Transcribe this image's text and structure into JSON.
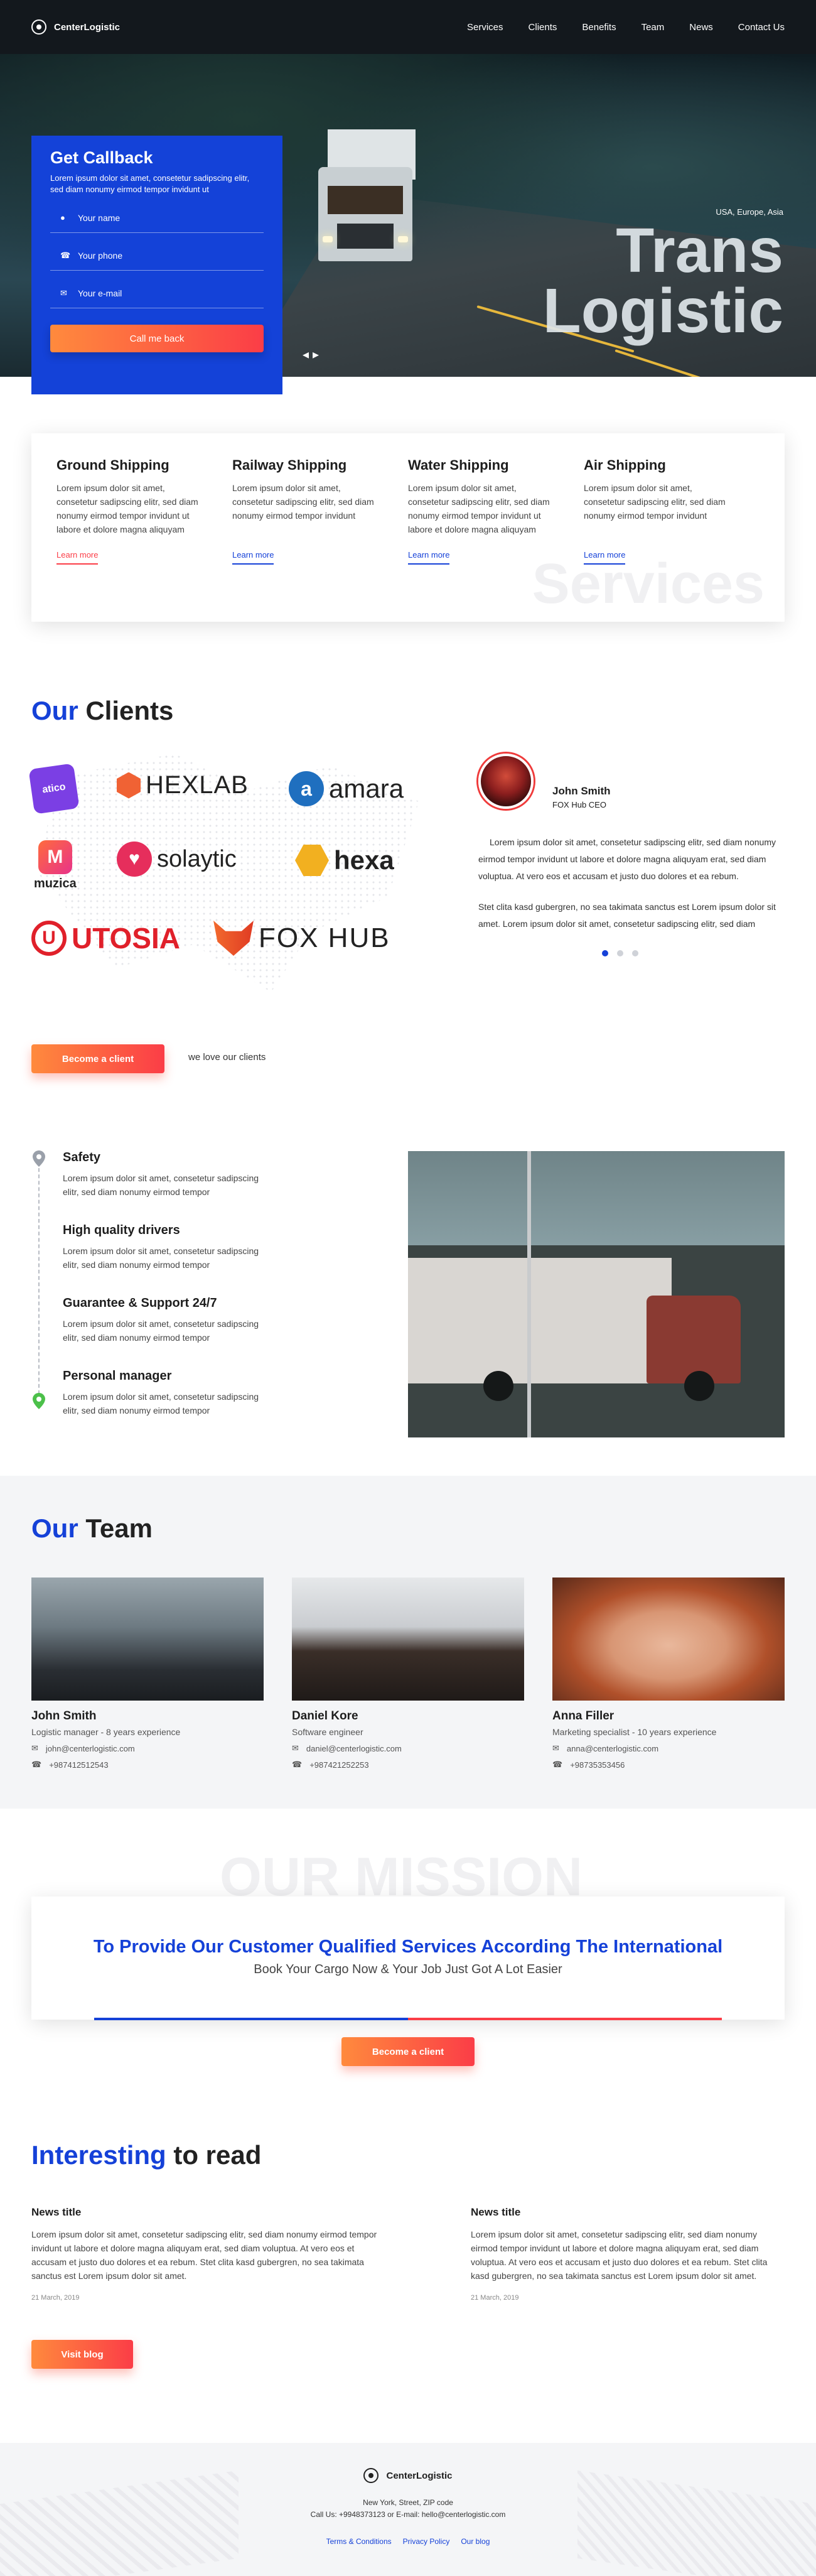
{
  "header": {
    "brand": "CenterLogistic",
    "nav": [
      "Services",
      "Clients",
      "Benefits",
      "Team",
      "News",
      "Contact Us"
    ]
  },
  "hero": {
    "location": "USA, Europe, Asia",
    "title_line1": "Trans",
    "title_line2": "Logistic"
  },
  "callback": {
    "title": "Get Callback",
    "description": "Lorem ipsum dolor sit amet, consetetur sadipscing elitr, sed diam nonumy eirmod tempor invidunt ut",
    "name_placeholder": "Your name",
    "phone_placeholder": "Your phone",
    "email_placeholder": "Your e-mail",
    "button": "Call me back"
  },
  "services": {
    "watermark": "Services",
    "items": [
      {
        "title": "Ground Shipping",
        "text": "Lorem ipsum dolor sit amet, consetetur sadipscing elitr, sed diam nonumy eirmod tempor invidunt ut labore et dolore magna aliquyam",
        "link": "Learn more",
        "color": "#fb3d47"
      },
      {
        "title": "Railway Shipping",
        "text": "Lorem ipsum dolor sit amet, consetetur sadipscing elitr, sed diam nonumy eirmod tempor invidunt",
        "link": "Learn more",
        "color": "#1541d8"
      },
      {
        "title": "Water Shipping",
        "text": "Lorem ipsum dolor sit amet, consetetur sadipscing elitr, sed diam nonumy eirmod tempor invidunt ut labore et dolore magna aliquyam",
        "link": "Learn more",
        "color": "#1541d8"
      },
      {
        "title": "Air Shipping",
        "text": "Lorem ipsum dolor sit amet, consetetur sadipscing elitr, sed diam nonumy eirmod tempor invidunt",
        "link": "Learn more",
        "color": "#1541d8"
      }
    ]
  },
  "clients": {
    "title_accent": "Our",
    "title_rest": "Clients",
    "logos": [
      "atico",
      "HEXLAB",
      "amara",
      "muzica",
      "solaytic",
      "hexa",
      "UTOSIA",
      "FOX HUB"
    ],
    "testimonial": {
      "name": "John Smith",
      "role": "FOX Hub CEO",
      "text1": "Lorem ipsum dolor sit amet, consetetur sadipscing elitr, sed diam nonumy eirmod tempor invidunt ut labore et dolore magna aliquyam erat, sed diam voluptua. At vero eos et accusam et justo duo dolores et ea rebum.",
      "text2": "Stet clita kasd gubergren, no sea takimata sanctus est Lorem ipsum dolor sit amet. Lorem ipsum dolor sit amet, consetetur sadipscing elitr, sed diam"
    },
    "button": "Become a client",
    "tagline": "we love our clients"
  },
  "benefits": [
    {
      "title": "Safety",
      "text": "Lorem ipsum dolor sit amet, consetetur sadipscing elitr, sed diam nonumy eirmod tempor"
    },
    {
      "title": "High quality drivers",
      "text": "Lorem ipsum dolor sit amet, consetetur sadipscing elitr, sed diam nonumy eirmod tempor"
    },
    {
      "title": "Guarantee & Support 24/7",
      "text": "Lorem ipsum dolor sit amet, consetetur sadipscing elitr, sed diam nonumy eirmod tempor"
    },
    {
      "title": "Personal manager",
      "text": "Lorem ipsum dolor sit amet, consetetur sadipscing elitr, sed diam nonumy eirmod tempor"
    }
  ],
  "team": {
    "title_accent": "Our",
    "title_rest": "Team",
    "members": [
      {
        "name": "John Smith",
        "role": "Logistic manager - 8 years experience",
        "email": "john@centerlogistic.com",
        "phone": "+987412512543"
      },
      {
        "name": "Daniel Kore",
        "role": "Software engineer",
        "email": "daniel@centerlogistic.com",
        "phone": "+987421252253"
      },
      {
        "name": "Anna Filler",
        "role": "Marketing specialist - 10 years experience",
        "email": "anna@centerlogistic.com",
        "phone": "+98735353456"
      }
    ]
  },
  "mission": {
    "watermark": "OUR MISSION",
    "heading": "To Provide Our Customer Qualified Services According The International",
    "sub": "Book Your Cargo Now & Your Job Just Got A Lot Easier",
    "button": "Become a client"
  },
  "news": {
    "title_accent": "Interesting",
    "title_rest": "to read",
    "items": [
      {
        "title": "News title",
        "text": "Lorem ipsum dolor sit amet, consetetur sadipscing elitr, sed diam nonumy eirmod tempor invidunt ut labore et dolore magna aliquyam erat, sed diam voluptua. At vero eos et accusam et justo duo dolores et ea rebum. Stet clita kasd gubergren, no sea takimata sanctus est Lorem ipsum dolor sit amet.",
        "date": "21 March, 2019"
      },
      {
        "title": "News title",
        "text": "Lorem ipsum dolor sit amet, consetetur sadipscing elitr, sed diam nonumy eirmod tempor invidunt ut labore et dolore magna aliquyam erat, sed diam voluptua. At vero eos et accusam et justo duo dolores et ea rebum. Stet clita kasd gubergren, no sea takimata sanctus est Lorem ipsum dolor sit amet.",
        "date": "21 March, 2019"
      }
    ],
    "button": "Visit blog"
  },
  "footer": {
    "brand": "CenterLogistic",
    "address": "New York, Street, ZIP code",
    "contact": "Call Us: +9948373123 or E-mail: hello@centerlogistic.com",
    "links": [
      "Terms & Conditions",
      "Privacy Policy",
      "Our blog"
    ]
  },
  "colors": {
    "primary": "#1541d8",
    "accent_start": "#ff8a3d",
    "accent_end": "#fb3d47"
  }
}
